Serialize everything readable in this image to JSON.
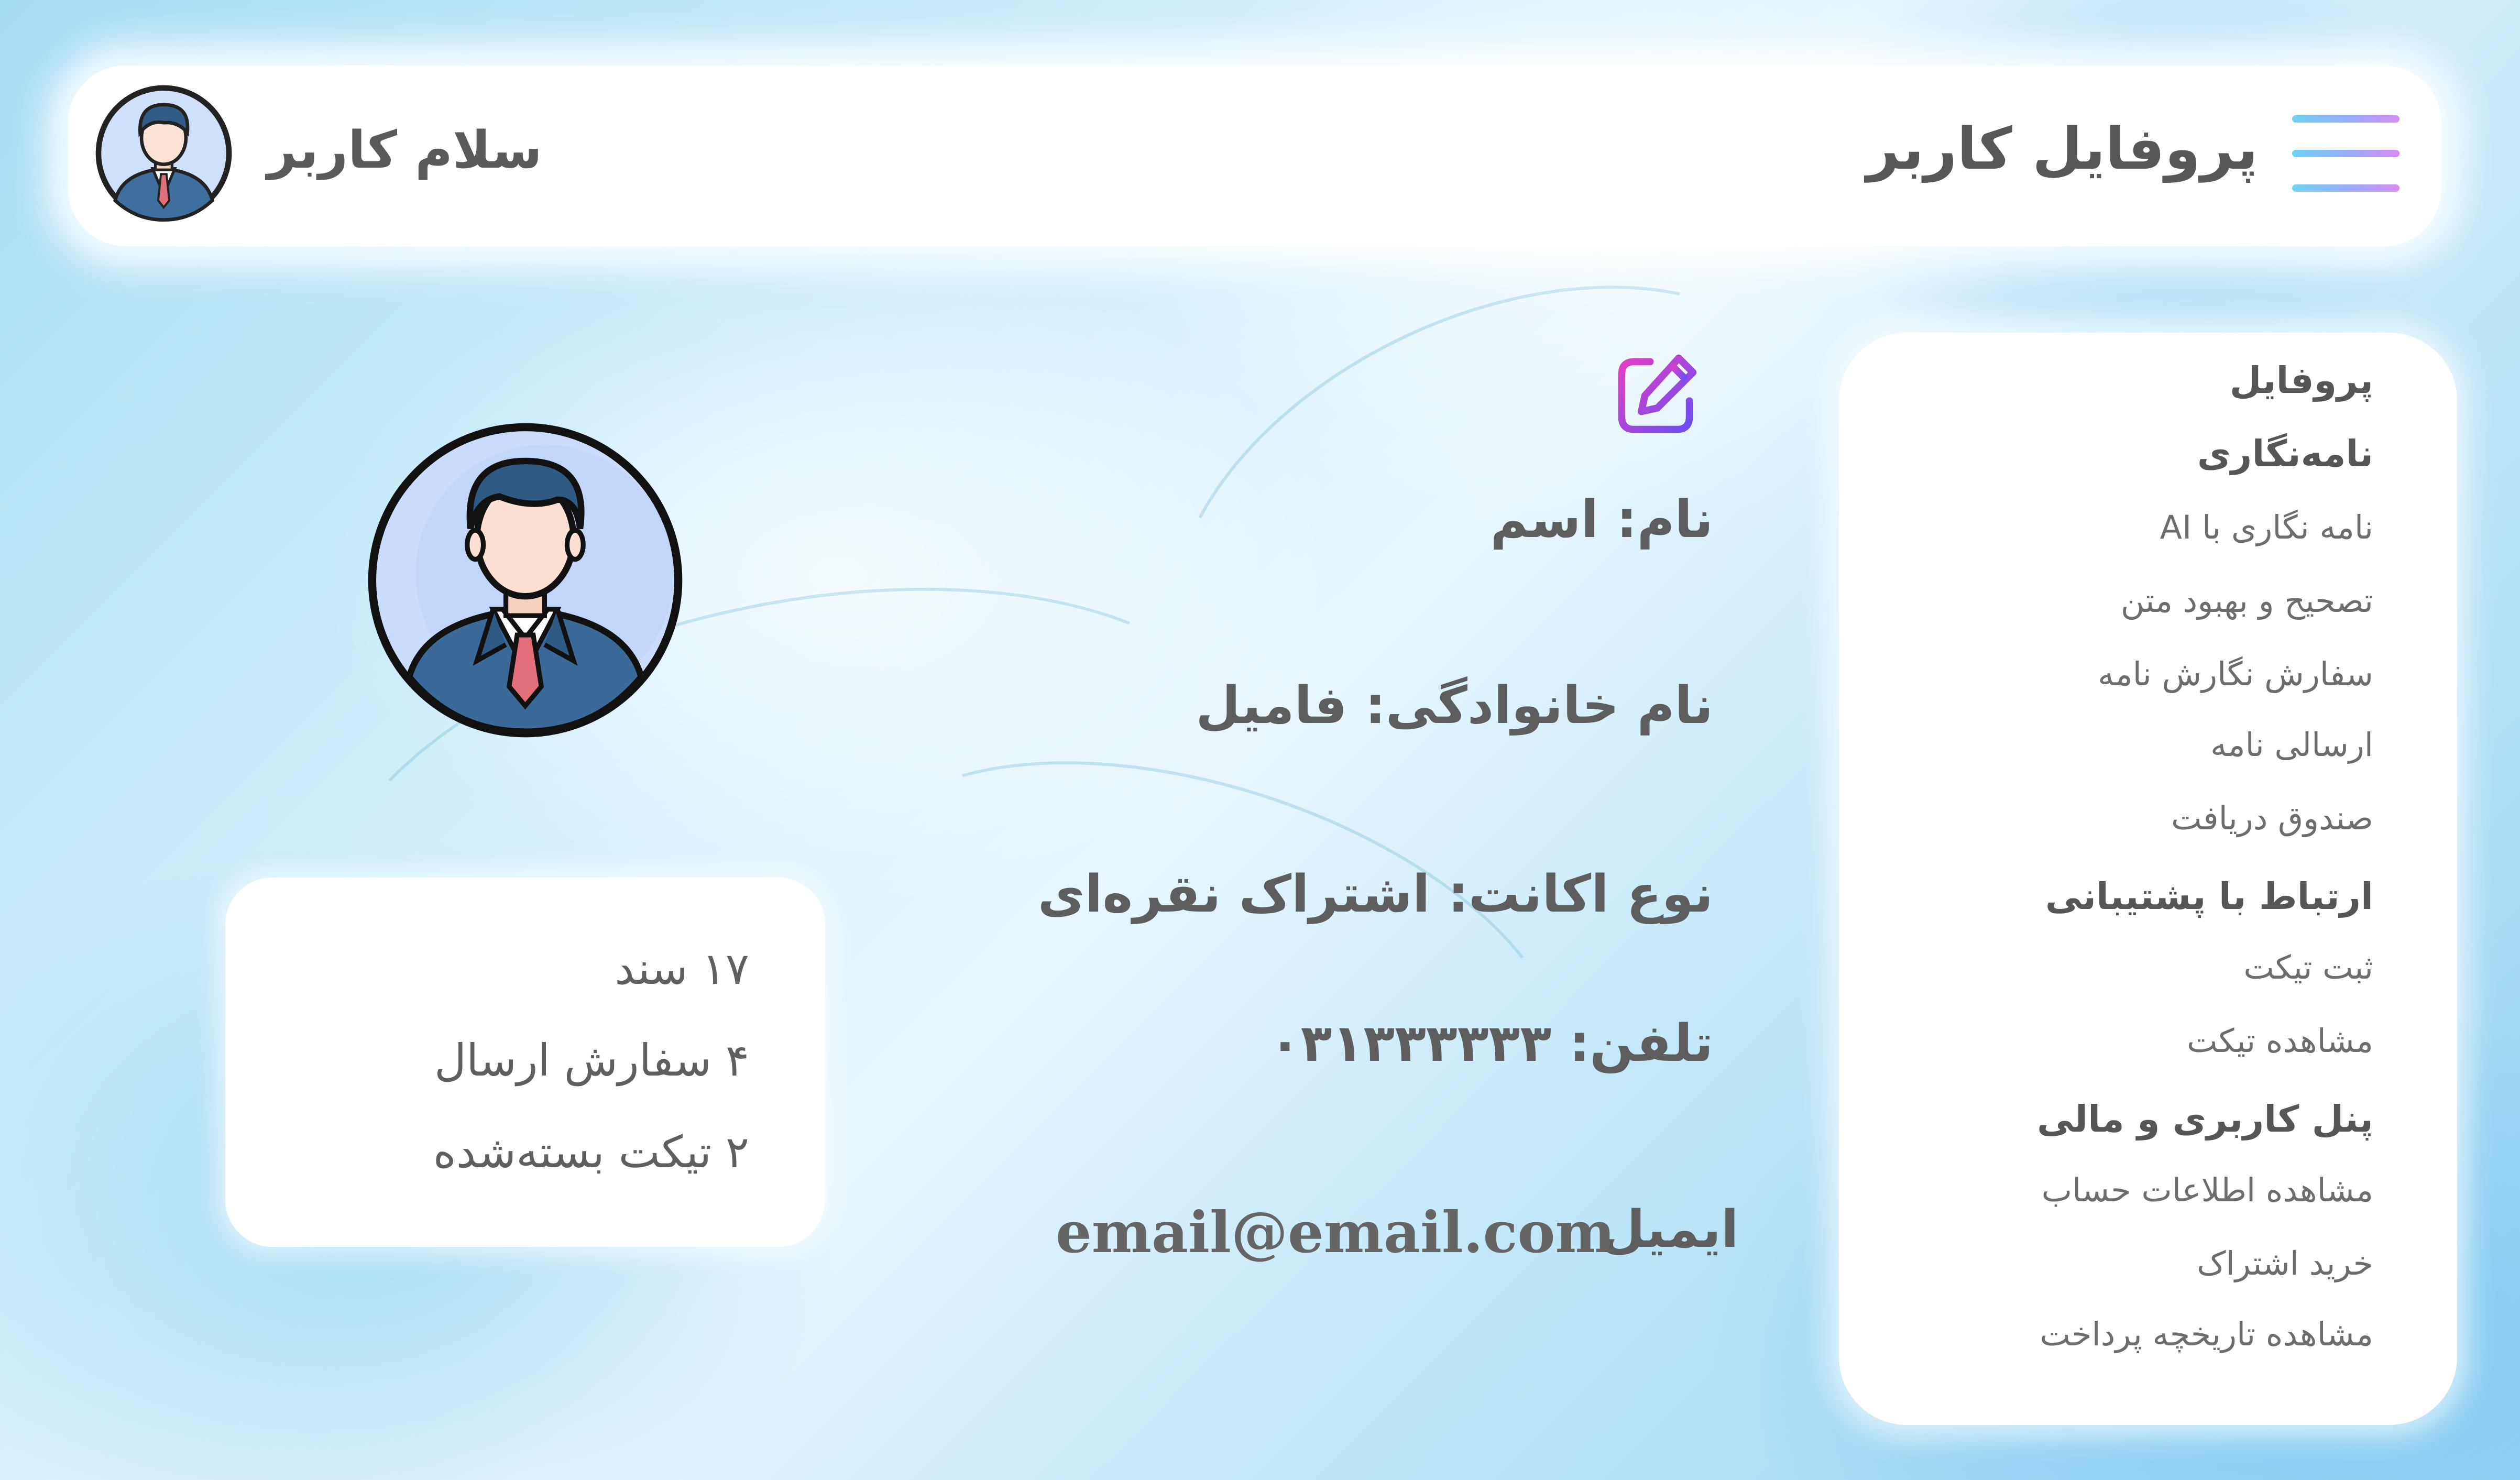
{
  "header": {
    "title": "پروفایل کاربر",
    "greeting": "سلام کاربر"
  },
  "menu": {
    "items": [
      {
        "label": "پروفایل",
        "kind": "section"
      },
      {
        "label": "نامه‌نگاری",
        "kind": "section"
      },
      {
        "label": "نامه نگاری با AI",
        "kind": "sub"
      },
      {
        "label": "تصحیح و بهبود متن",
        "kind": "sub"
      },
      {
        "label": "سفارش نگارش نامه",
        "kind": "sub"
      },
      {
        "label": "ارسالی نامه",
        "kind": "sub"
      },
      {
        "label": "صندوق دریافت",
        "kind": "sub"
      },
      {
        "label": "ارتباط با پشتیبانی",
        "kind": "section"
      },
      {
        "label": "ثبت تیکت",
        "kind": "sub"
      },
      {
        "label": "مشاهده تیکت",
        "kind": "sub"
      },
      {
        "label": "پنل کاربری و مالی",
        "kind": "section"
      },
      {
        "label": "مشاهده اطلاعات حساب",
        "kind": "sub"
      },
      {
        "label": "خرید اشتراک",
        "kind": "sub"
      },
      {
        "label": "مشاهده تاریخچه پرداخت",
        "kind": "sub"
      }
    ]
  },
  "profile": {
    "name": "نام: اسم",
    "family": "نام خانوادگی: فامیل",
    "account_type": "نوع اکانت: اشتراک نقره‌ای",
    "phone": "تلفن: ۰۳۱۳۳۳۳۳۳",
    "email_label": "ایمیل",
    "email": "email@email.com"
  },
  "stats": {
    "documents": "۱۷ سند",
    "orders": "۴ سفارش ارسال",
    "tickets": "۲ تیکت بسته‌شده"
  },
  "icons": {
    "menu": "hamburger-menu-icon",
    "edit": "edit-icon",
    "avatar": "user-avatar-icon"
  },
  "colors": {
    "accent_start": "#6fd3f6",
    "accent_end": "#d58cf4",
    "text": "#5d5d5d"
  }
}
